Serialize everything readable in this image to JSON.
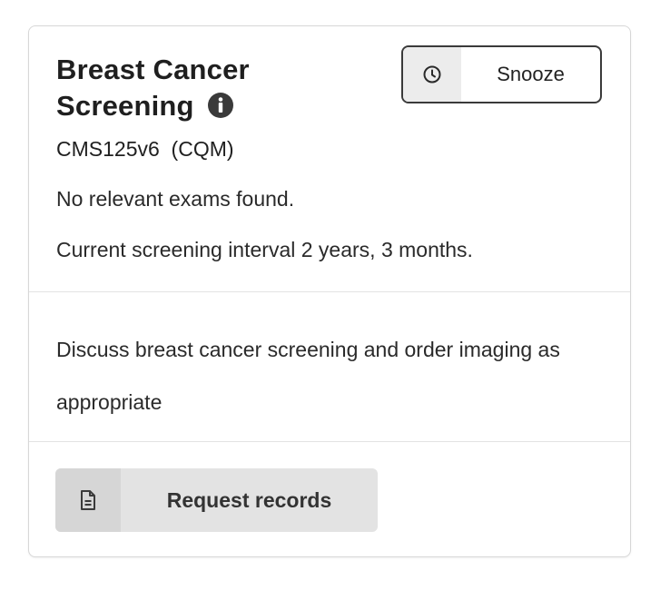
{
  "card": {
    "title_line1": "Breast Cancer",
    "title_line2": "Screening",
    "measure": "CMS125v6  (CQM)",
    "status": [
      "No relevant exams found.",
      "Current screening interval 2 years, 3 months."
    ],
    "recommendation": "Discuss breast cancer screening and order imaging as appropriate"
  },
  "buttons": {
    "snooze_label": "Snooze",
    "snooze_icon": "clock-icon",
    "request_label": "Request records",
    "request_icon": "document-icon"
  },
  "icons": {
    "info": "info-icon"
  },
  "colors": {
    "border": "#d7d7d7",
    "text": "#222222",
    "button_bg": "#e3e3e3",
    "icon_bg": "#d6d6d6",
    "info_icon": "#3a3a3a"
  }
}
